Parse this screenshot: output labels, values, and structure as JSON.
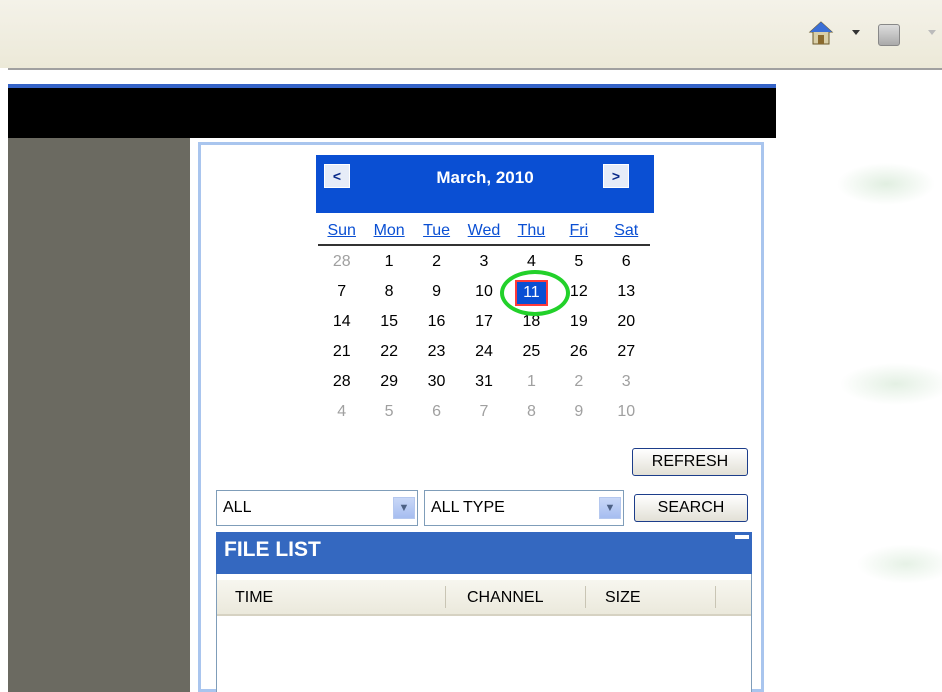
{
  "calendar": {
    "title": "March, 2010",
    "prev_label": "<",
    "next_label": ">",
    "weekdays": [
      "Sun",
      "Mon",
      "Tue",
      "Wed",
      "Thu",
      "Fri",
      "Sat"
    ],
    "weeks": [
      [
        {
          "d": "28",
          "o": true
        },
        {
          "d": "1"
        },
        {
          "d": "2"
        },
        {
          "d": "3"
        },
        {
          "d": "4"
        },
        {
          "d": "5"
        },
        {
          "d": "6"
        }
      ],
      [
        {
          "d": "7"
        },
        {
          "d": "8"
        },
        {
          "d": "9"
        },
        {
          "d": "10"
        },
        {
          "d": "11",
          "s": true
        },
        {
          "d": "12"
        },
        {
          "d": "13"
        }
      ],
      [
        {
          "d": "14"
        },
        {
          "d": "15"
        },
        {
          "d": "16"
        },
        {
          "d": "17"
        },
        {
          "d": "18"
        },
        {
          "d": "19"
        },
        {
          "d": "20"
        }
      ],
      [
        {
          "d": "21"
        },
        {
          "d": "22"
        },
        {
          "d": "23"
        },
        {
          "d": "24"
        },
        {
          "d": "25"
        },
        {
          "d": "26"
        },
        {
          "d": "27"
        }
      ],
      [
        {
          "d": "28"
        },
        {
          "d": "29"
        },
        {
          "d": "30"
        },
        {
          "d": "31"
        },
        {
          "d": "1",
          "o": true
        },
        {
          "d": "2",
          "o": true
        },
        {
          "d": "3",
          "o": true
        }
      ],
      [
        {
          "d": "4",
          "o": true
        },
        {
          "d": "5",
          "o": true
        },
        {
          "d": "6",
          "o": true
        },
        {
          "d": "7",
          "o": true
        },
        {
          "d": "8",
          "o": true
        },
        {
          "d": "9",
          "o": true
        },
        {
          "d": "10",
          "o": true
        }
      ]
    ]
  },
  "controls": {
    "refresh_label": "REFRESH",
    "search_label": "SEARCH",
    "channel_select": "ALL",
    "type_select": "ALL TYPE"
  },
  "file_list": {
    "title": "FILE LIST",
    "columns": [
      "TIME",
      "CHANNEL",
      "SIZE"
    ]
  },
  "colors": {
    "calendar_header": "#0a4fd3",
    "file_list_header": "#3468c0",
    "highlight_circle": "#22d12a"
  }
}
